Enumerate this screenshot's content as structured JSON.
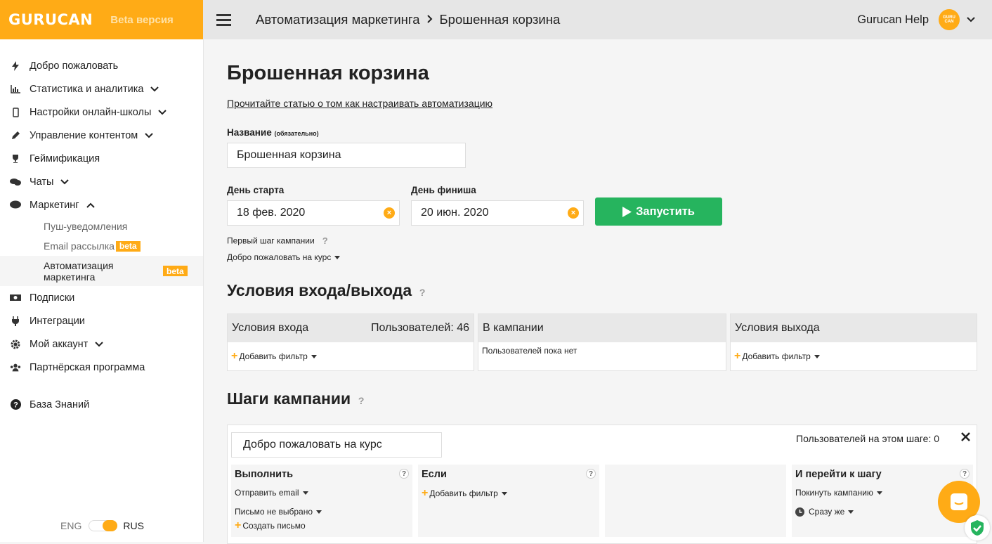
{
  "brand": {
    "logo": "GURUCAN",
    "beta": "Beta версия"
  },
  "sidebar": {
    "items": [
      {
        "label": "Добро пожаловать",
        "icon": "bolt-icon"
      },
      {
        "label": "Статистика и аналитика",
        "icon": "chart-icon"
      },
      {
        "label": "Настройки онлайн-школы",
        "icon": "mobile-icon"
      },
      {
        "label": "Управление контентом",
        "icon": "pencil-icon"
      },
      {
        "label": "Геймификация",
        "icon": "trophy-icon"
      },
      {
        "label": "Чаты",
        "icon": "comments-icon"
      },
      {
        "label": "Маркетинг",
        "icon": "comment-icon"
      },
      {
        "label": "Подписки",
        "icon": "money-icon"
      },
      {
        "label": "Интеграции",
        "icon": "plug-icon"
      },
      {
        "label": "Мой аккаунт",
        "icon": "gear-icon"
      },
      {
        "label": "Партнёрская программа",
        "icon": "users-icon"
      }
    ],
    "sub": [
      {
        "label": "Пуш-уведомления"
      },
      {
        "label": "Email рассылка",
        "badge": "beta"
      },
      {
        "label": "Автоматизация маркетинга",
        "badge": "beta"
      }
    ],
    "kb": "База Знаний",
    "lang_eng": "ENG",
    "lang_rus": "RUS"
  },
  "topbar": {
    "crumb1": "Автоматизация маркетинга",
    "crumb2": "Брошенная корзина",
    "help": "Gurucan Help",
    "avatar": "GURU CAN"
  },
  "page": {
    "title": "Брошенная корзина",
    "article_link": "Прочитайте статью о том как настраивать автоматизацию",
    "name_label": "Название",
    "name_hint": "(обязательно)",
    "name_value": "Брошенная корзина",
    "start_label": "День старта",
    "start_value": "18 фев. 2020",
    "end_label": "День финиша",
    "end_value": "20 июн. 2020",
    "run_button": "Запустить",
    "first_step_label": "Первый шаг кампании",
    "first_step_value": "Добро пожаловать на курс",
    "conditions_title": "Условия входа/выхода",
    "entry_title": "Условия входа",
    "entry_users": "Пользователей: 46",
    "add_filter": "Добавить фильтр",
    "in_campaign_title": "В кампании",
    "no_users": "Пользователей пока нет",
    "exit_title": "Условия выхода",
    "steps_title": "Шаги кампании",
    "step_name": "Добро пожаловать на курс",
    "step_users": "Пользователей на этом шаге: 0",
    "do_title": "Выполнить",
    "do_action": "Отправить email",
    "do_letter": "Письмо не выбрано",
    "do_create": "Создать письмо",
    "if_title": "Если",
    "if_filter": "Добавить фильтр",
    "goto_title": "И перейти к шагу",
    "goto_value": "Покинуть кампанию",
    "goto_time": "Сразу же"
  },
  "colors": {
    "accent": "#ffab16",
    "run": "#26b45e"
  }
}
